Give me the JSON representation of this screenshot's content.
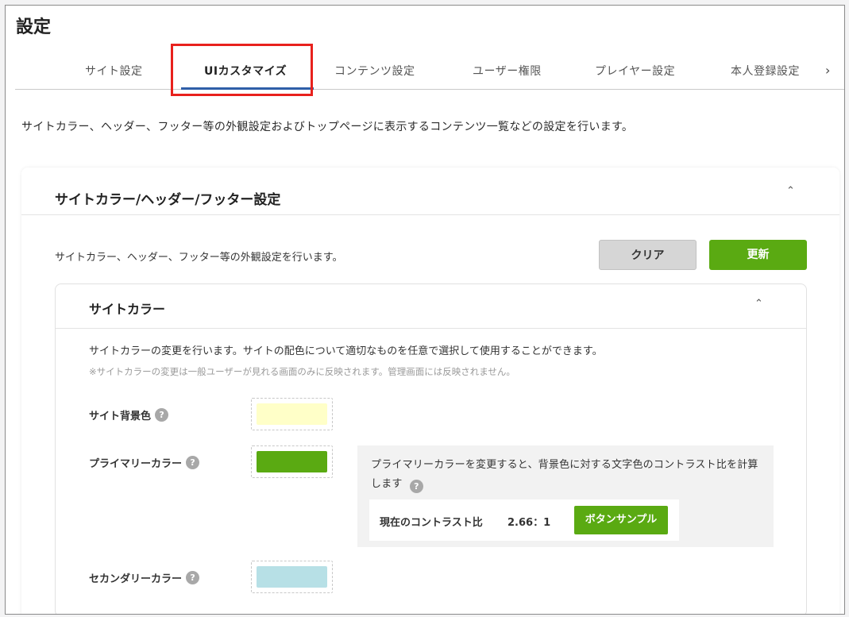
{
  "page": {
    "title": "設定"
  },
  "tabs": [
    {
      "label": "サイト設定",
      "active": false
    },
    {
      "label": "UIカスタマイズ",
      "active": true
    },
    {
      "label": "コンテンツ設定",
      "active": false
    },
    {
      "label": "ユーザー権限",
      "active": false
    },
    {
      "label": "プレイヤー設定",
      "active": false
    },
    {
      "label": "本人登録設定",
      "active": false
    }
  ],
  "icons": {
    "tab_next": "chevron-right-icon",
    "collapse": "chevron-up-icon",
    "help": "question-circle-icon"
  },
  "intro": "サイトカラー、ヘッダー、フッター等の外観設定およびトップページに表示するコンテンツ一覧などの設定を行います。",
  "section": {
    "title": "サイトカラー/ヘッダー/フッター設定",
    "description": "サイトカラー、ヘッダー、フッター等の外観設定を行います。",
    "clear_label": "クリア",
    "update_label": "更新",
    "site_color": {
      "title": "サイトカラー",
      "description": "サイトカラーの変更を行います。サイトの配色について適切なものを任意で選択して使用することができます。",
      "note": "※サイトカラーの変更は一般ユーザーが見れる画面のみに反映されます。管理画面には反映されません。",
      "fields": [
        {
          "label": "サイト背景色",
          "color": "#ffffc8"
        },
        {
          "label": "プライマリーカラー",
          "color": "#5aaa12"
        },
        {
          "label": "セカンダリーカラー",
          "color": "#b7e0e6"
        }
      ],
      "contrast": {
        "text": "プライマリーカラーを変更すると、背景色に対する文字色のコントラスト比を計算します",
        "ratio_label": "現在のコントラスト比",
        "ratio_value": "2.66：1",
        "sample_button": "ボタンサンプル"
      }
    }
  },
  "colors": {
    "accent": "#5aaa12",
    "tab_underline": "#2f5fa8",
    "highlight": "#e8211d"
  }
}
